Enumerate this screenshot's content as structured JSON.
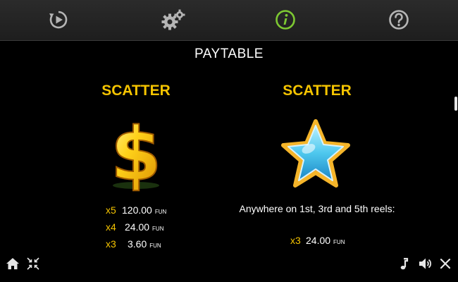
{
  "topbar": {
    "icons": [
      "autoplay-icon",
      "settings-icon",
      "info-icon",
      "help-icon"
    ],
    "active_color": "#7dc832",
    "inactive_color": "#b5b5b5"
  },
  "page": {
    "title": "PAYTABLE"
  },
  "left_symbol": {
    "title": "SCATTER",
    "icon": "dollar-sign-icon",
    "payouts": [
      {
        "mult": "x5",
        "amount": "120.00",
        "unit": "FUN"
      },
      {
        "mult": "x4",
        "amount": "24.00",
        "unit": "FUN"
      },
      {
        "mult": "x3",
        "amount": "3.60",
        "unit": "FUN"
      }
    ]
  },
  "right_symbol": {
    "title": "SCATTER",
    "icon": "blue-star-icon",
    "description": "Anywhere on 1st, 3rd and 5th reels:",
    "payouts": [
      {
        "mult": "x3",
        "amount": "24.00",
        "unit": "FUN"
      }
    ]
  },
  "bottombar": {
    "left_icons": [
      "home-icon",
      "minimize-icon"
    ],
    "right_icons": [
      "music-icon",
      "sound-icon",
      "close-icon"
    ]
  },
  "colors": {
    "accent": "#f5c400",
    "background": "#000000"
  }
}
